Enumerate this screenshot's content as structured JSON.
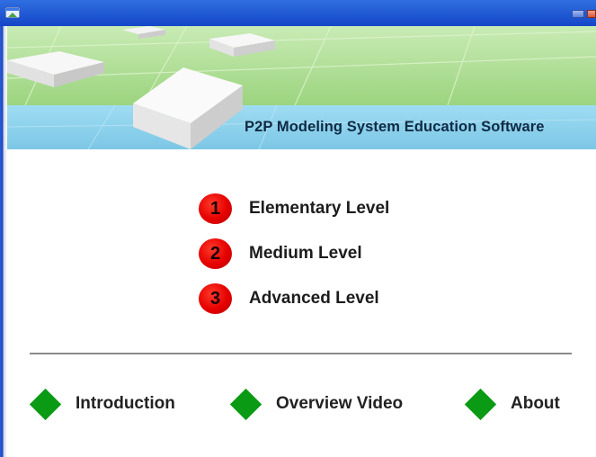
{
  "banner": {
    "title": "P2P Modeling System Education Software"
  },
  "levels": [
    {
      "number": "1",
      "label": "Elementary Level"
    },
    {
      "number": "2",
      "label": "Medium Level"
    },
    {
      "number": "3",
      "label": "Advanced Level"
    }
  ],
  "links": [
    {
      "label": "Introduction"
    },
    {
      "label": "Overview Video"
    },
    {
      "label": "About"
    }
  ],
  "colors": {
    "titlebar": "#1f5ad8",
    "level_badge": "#e50000",
    "link_diamond": "#0a9a14",
    "banner_strip": "#8ed3ee"
  },
  "icons": {
    "window": "app-window-icon",
    "minimize": "minimize-icon",
    "close": "close-icon"
  }
}
